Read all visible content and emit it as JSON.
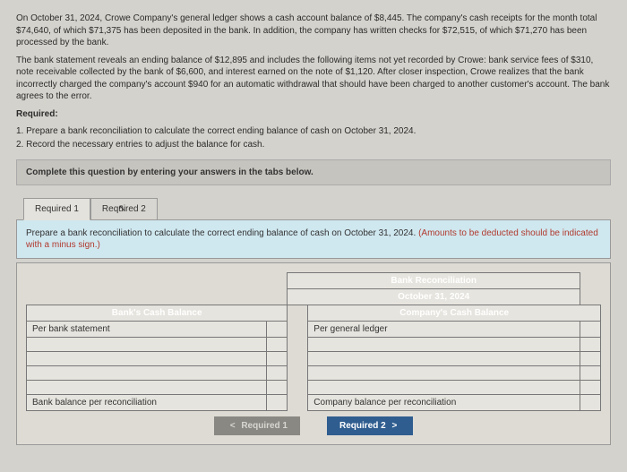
{
  "problem": {
    "p1": "On October 31, 2024, Crowe Company's general ledger shows a cash account balance of $8,445. The company's cash receipts for the month total $74,640, of which $71,375 has been deposited in the bank. In addition, the company has written checks for $72,515, of which $71,270 has been processed by the bank.",
    "p2": "The bank statement reveals an ending balance of $12,895 and includes the following items not yet recorded by Crowe: bank service fees of $310, note receivable collected by the bank of $6,600, and interest earned on the note of $1,120. After closer inspection, Crowe realizes that the bank incorrectly charged the company's account $940 for an automatic withdrawal that should have been charged to another customer's account. The bank agrees to the error.",
    "required_heading": "Required:",
    "req1": "1. Prepare a bank reconciliation to calculate the correct ending balance of cash on October 31, 2024.",
    "req2": "2. Record the necessary entries to adjust the balance for cash."
  },
  "complete_bar": "Complete this question by entering your answers in the tabs below.",
  "tabs": {
    "t1": "Required 1",
    "t2": "Required 2"
  },
  "instruction": {
    "main": "Prepare a bank reconciliation to calculate the correct ending balance of cash on October 31, 2024. ",
    "deduct": "(Amounts to be deducted should be indicated with a minus sign.)"
  },
  "recon": {
    "title": "Bank Reconciliation",
    "date": "October 31, 2024",
    "bank_header": "Bank's Cash Balance",
    "company_header": "Company's Cash Balance",
    "per_bank": "Per bank statement",
    "per_ledger": "Per general ledger",
    "bank_balance_row": "Bank balance per reconciliation",
    "company_balance_row": "Company balance per reconciliation"
  },
  "nav": {
    "prev": "Required 1",
    "next": "Required 2"
  }
}
